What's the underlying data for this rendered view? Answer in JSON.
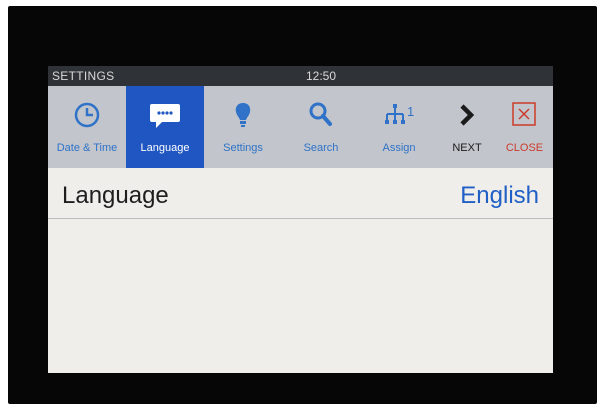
{
  "statusbar": {
    "title": "SETTINGS",
    "time": "12:50"
  },
  "toolbar": {
    "items": [
      {
        "label": "Date & Time",
        "icon": "clock-icon"
      },
      {
        "label": "Language",
        "icon": "speech-bubble-icon",
        "active": true
      },
      {
        "label": "Settings",
        "icon": "lightbulb-icon"
      },
      {
        "label": "Search",
        "icon": "magnifier-icon"
      },
      {
        "label": "Assign",
        "icon": "network-icon",
        "icon_text": "1"
      },
      {
        "label": "NEXT",
        "icon": "chevron-right-icon"
      },
      {
        "label": "CLOSE",
        "icon": "close-icon"
      }
    ]
  },
  "content": {
    "label": "Language",
    "value": "English"
  },
  "colors": {
    "accent": "#1f56c2",
    "toolbar": "#c2c6cc",
    "close": "#cc3a2a"
  }
}
